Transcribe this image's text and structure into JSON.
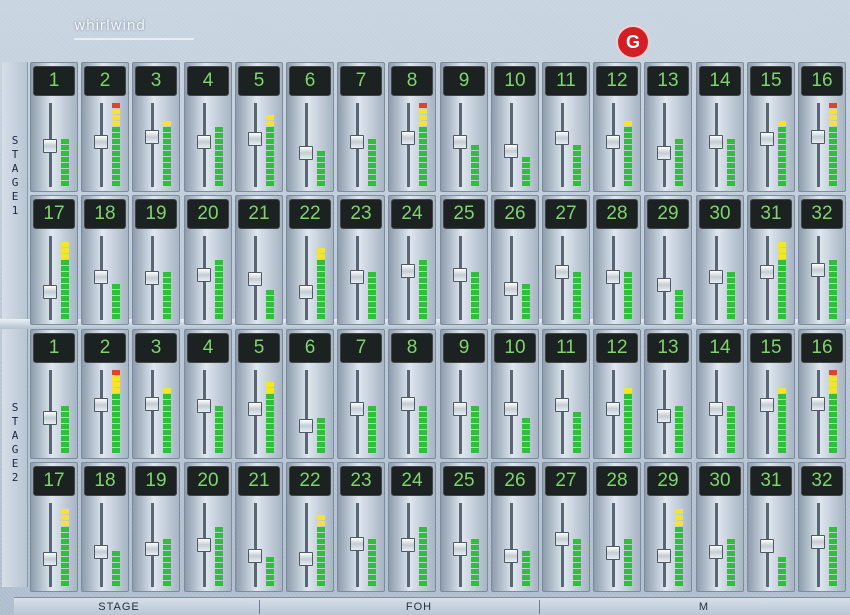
{
  "app": {
    "brand": "whirlwind",
    "brand_sub": "",
    "vendor_name": ""
  },
  "colors": {
    "meter_green": "#2fbf3a",
    "meter_yellow": "#f4e52c",
    "meter_red": "#e0422a",
    "channel_number": "#7fd46e"
  },
  "panels": [
    {
      "side_label": [
        "S",
        "T",
        "A",
        "G",
        "E",
        "1"
      ],
      "rows": [
        {
          "channels": [
            {
              "number": "1",
              "fader": 0.48,
              "meter": 0.55
            },
            {
              "number": "2",
              "fader": 0.55,
              "meter": 1.0
            },
            {
              "number": "3",
              "fader": 0.62,
              "meter": 0.82
            },
            {
              "number": "4",
              "fader": 0.55,
              "meter": 0.72
            },
            {
              "number": "5",
              "fader": 0.58,
              "meter": 0.85
            },
            {
              "number": "6",
              "fader": 0.38,
              "meter": 0.42
            },
            {
              "number": "7",
              "fader": 0.55,
              "meter": 0.6
            },
            {
              "number": "8",
              "fader": 0.6,
              "meter": 1.0
            },
            {
              "number": "9",
              "fader": 0.55,
              "meter": 0.48
            },
            {
              "number": "10",
              "fader": 0.42,
              "meter": 0.35
            },
            {
              "number": "11",
              "fader": 0.6,
              "meter": 0.5
            },
            {
              "number": "12",
              "fader": 0.55,
              "meter": 0.82
            },
            {
              "number": "13",
              "fader": 0.38,
              "meter": 0.6
            },
            {
              "number": "14",
              "fader": 0.55,
              "meter": 0.55
            },
            {
              "number": "15",
              "fader": 0.58,
              "meter": 0.82
            },
            {
              "number": "16",
              "fader": 0.62,
              "meter": 0.98
            }
          ]
        },
        {
          "channels": [
            {
              "number": "17",
              "fader": 0.3,
              "meter": 0.92
            },
            {
              "number": "18",
              "fader": 0.52,
              "meter": 0.45
            },
            {
              "number": "19",
              "fader": 0.5,
              "meter": 0.6
            },
            {
              "number": "20",
              "fader": 0.55,
              "meter": 0.72
            },
            {
              "number": "21",
              "fader": 0.48,
              "meter": 0.35
            },
            {
              "number": "22",
              "fader": 0.3,
              "meter": 0.88
            },
            {
              "number": "23",
              "fader": 0.52,
              "meter": 0.55
            },
            {
              "number": "24",
              "fader": 0.6,
              "meter": 0.72
            },
            {
              "number": "25",
              "fader": 0.55,
              "meter": 0.55
            },
            {
              "number": "26",
              "fader": 0.35,
              "meter": 0.4
            },
            {
              "number": "27",
              "fader": 0.58,
              "meter": 0.55
            },
            {
              "number": "28",
              "fader": 0.52,
              "meter": 0.58
            },
            {
              "number": "29",
              "fader": 0.4,
              "meter": 0.38
            },
            {
              "number": "30",
              "fader": 0.52,
              "meter": 0.58
            },
            {
              "number": "31",
              "fader": 0.58,
              "meter": 0.95
            },
            {
              "number": "32",
              "fader": 0.62,
              "meter": 0.72
            }
          ]
        }
      ]
    },
    {
      "side_label": [
        "S",
        "T",
        "A",
        "G",
        "E",
        "2"
      ],
      "rows": [
        {
          "channels": [
            {
              "number": "1",
              "fader": 0.42,
              "meter": 0.6
            },
            {
              "number": "2",
              "fader": 0.6,
              "meter": 1.0
            },
            {
              "number": "3",
              "fader": 0.62,
              "meter": 0.82
            },
            {
              "number": "4",
              "fader": 0.58,
              "meter": 0.6
            },
            {
              "number": "5",
              "fader": 0.55,
              "meter": 0.85
            },
            {
              "number": "6",
              "fader": 0.3,
              "meter": 0.42
            },
            {
              "number": "7",
              "fader": 0.55,
              "meter": 0.58
            },
            {
              "number": "8",
              "fader": 0.62,
              "meter": 0.58
            },
            {
              "number": "9",
              "fader": 0.55,
              "meter": 0.55
            },
            {
              "number": "10",
              "fader": 0.55,
              "meter": 0.4
            },
            {
              "number": "11",
              "fader": 0.6,
              "meter": 0.5
            },
            {
              "number": "12",
              "fader": 0.55,
              "meter": 0.82
            },
            {
              "number": "13",
              "fader": 0.45,
              "meter": 0.58
            },
            {
              "number": "14",
              "fader": 0.55,
              "meter": 0.58
            },
            {
              "number": "15",
              "fader": 0.6,
              "meter": 0.82
            },
            {
              "number": "16",
              "fader": 0.62,
              "meter": 1.0
            }
          ]
        },
        {
          "channels": [
            {
              "number": "17",
              "fader": 0.3,
              "meter": 0.92
            },
            {
              "number": "18",
              "fader": 0.4,
              "meter": 0.45
            },
            {
              "number": "19",
              "fader": 0.45,
              "meter": 0.6
            },
            {
              "number": "20",
              "fader": 0.5,
              "meter": 0.72
            },
            {
              "number": "21",
              "fader": 0.35,
              "meter": 0.35
            },
            {
              "number": "22",
              "fader": 0.3,
              "meter": 0.88
            },
            {
              "number": "23",
              "fader": 0.52,
              "meter": 0.58
            },
            {
              "number": "24",
              "fader": 0.5,
              "meter": 0.72
            },
            {
              "number": "25",
              "fader": 0.45,
              "meter": 0.6
            },
            {
              "number": "26",
              "fader": 0.35,
              "meter": 0.45
            },
            {
              "number": "27",
              "fader": 0.58,
              "meter": 0.58
            },
            {
              "number": "28",
              "fader": 0.38,
              "meter": 0.6
            },
            {
              "number": "29",
              "fader": 0.35,
              "meter": 0.95
            },
            {
              "number": "30",
              "fader": 0.4,
              "meter": 0.6
            },
            {
              "number": "31",
              "fader": 0.48,
              "meter": 0.38
            },
            {
              "number": "32",
              "fader": 0.55,
              "meter": 0.72
            }
          ]
        }
      ]
    }
  ],
  "tabs": [
    {
      "label": "STAGE"
    },
    {
      "label": "FOH"
    },
    {
      "label": "M"
    }
  ]
}
